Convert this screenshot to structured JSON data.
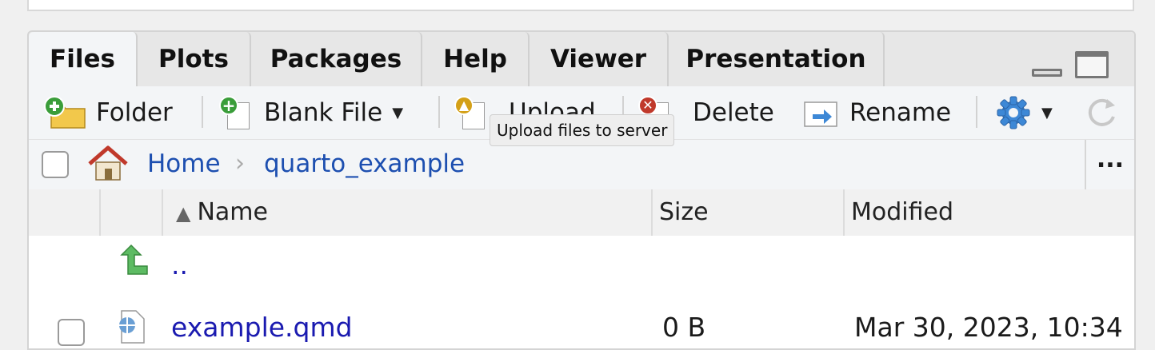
{
  "tabs": [
    "Files",
    "Plots",
    "Packages",
    "Help",
    "Viewer",
    "Presentation"
  ],
  "toolbar": {
    "folder_label": "Folder",
    "blank_file_label": "Blank File",
    "upload_label": "Upload",
    "delete_label": "Delete",
    "rename_label": "Rename",
    "caret": "▼"
  },
  "breadcrumb": {
    "home": "Home",
    "separator": "›",
    "current": "quarto_example",
    "more": "..."
  },
  "tooltip": "Upload files to server",
  "columns": {
    "name": "Name",
    "sort_indicator": "▲",
    "size": "Size",
    "modified": "Modified"
  },
  "rows": [
    {
      "name": "..",
      "size": "",
      "modified": ""
    },
    {
      "name": "example.qmd",
      "size": "0 B",
      "modified": "Mar 30, 2023, 10:34"
    }
  ],
  "colors": {
    "accent_link": "#1d4fb0",
    "add_green": "#3a9d3a",
    "delete_red": "#c0392b",
    "upload_gold": "#d4a017",
    "gear_blue": "#3d88d6"
  }
}
